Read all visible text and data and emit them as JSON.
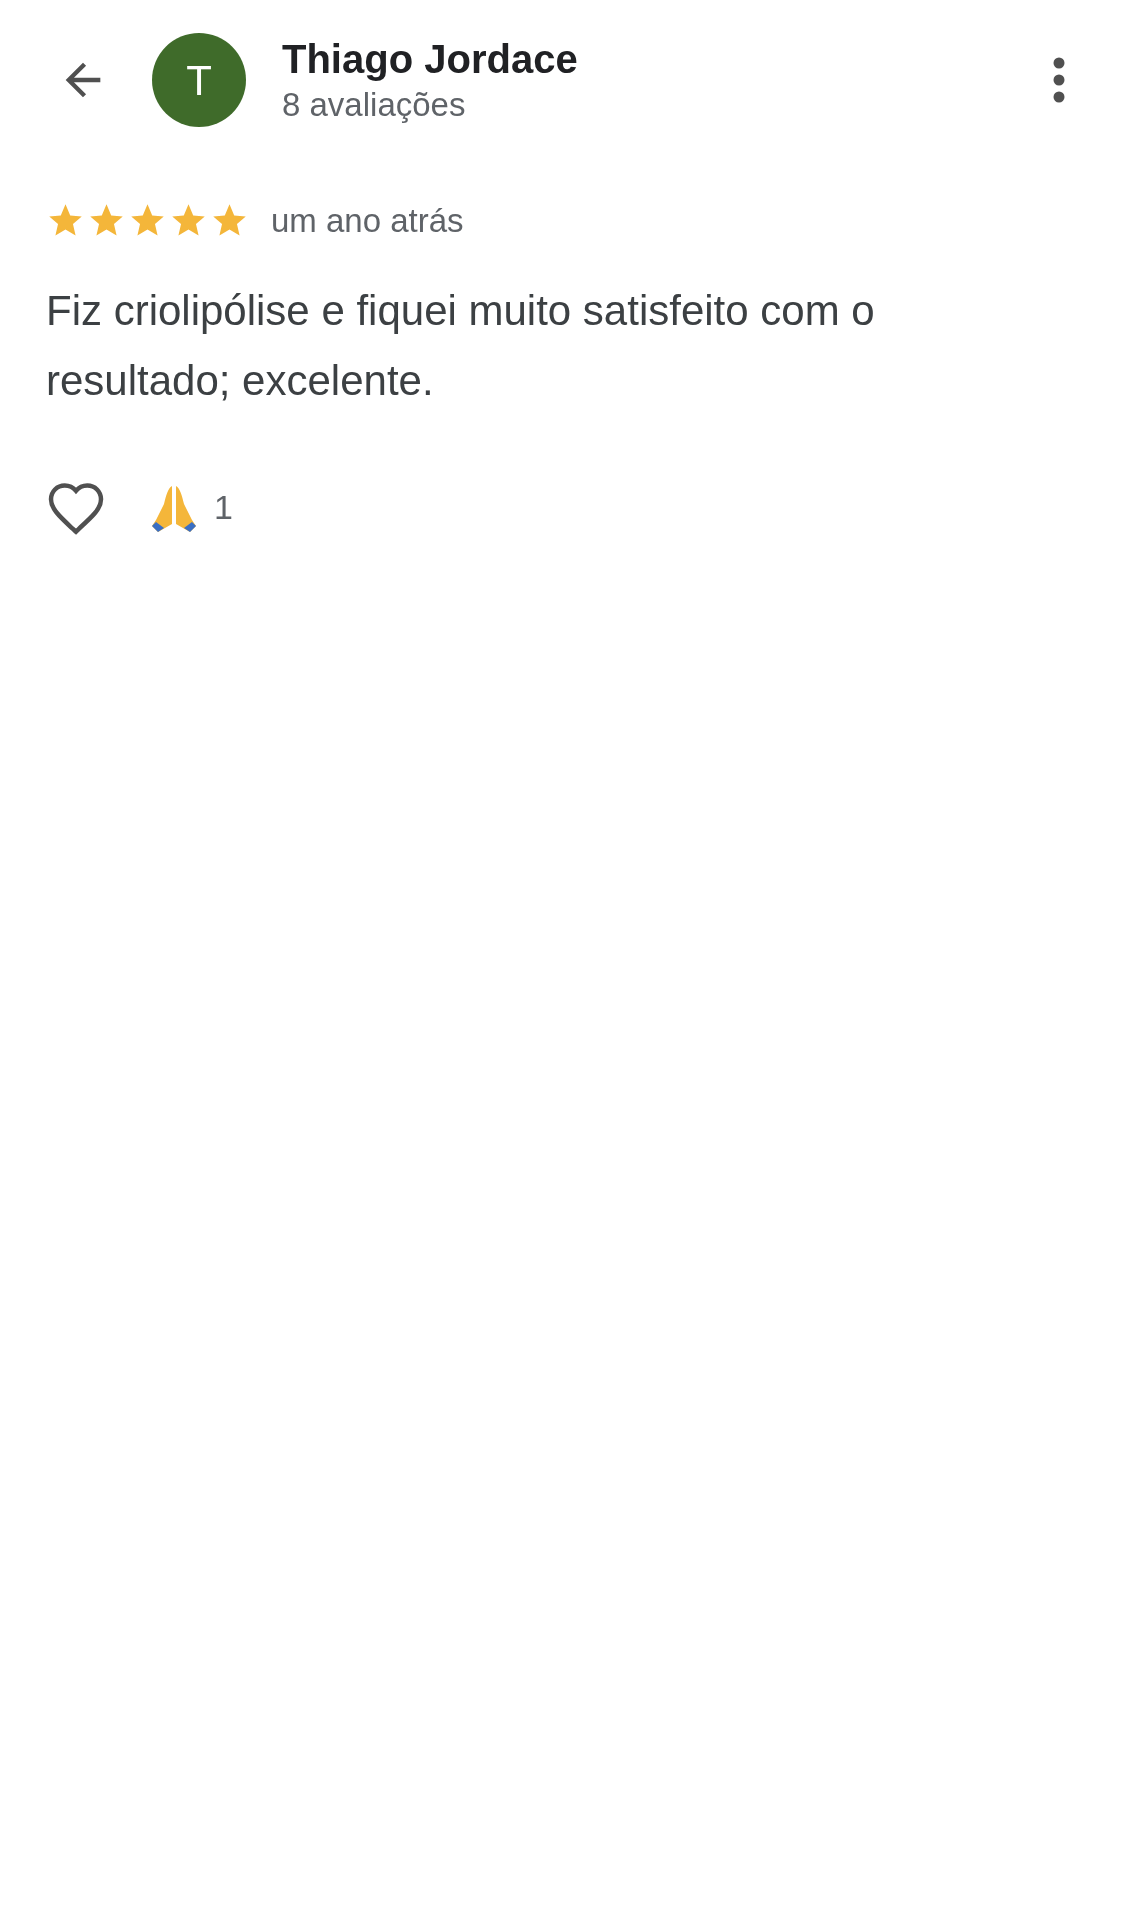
{
  "header": {
    "avatar_letter": "T",
    "name": "Thiago Jordace",
    "subtitle": "8 avaliações"
  },
  "review": {
    "stars": 5,
    "time": "um ano atrás",
    "text": "Fiz criolipólise e fiquei muito satisfeito com o resultado; excelente."
  },
  "reactions": {
    "liked": false,
    "count": "1"
  }
}
